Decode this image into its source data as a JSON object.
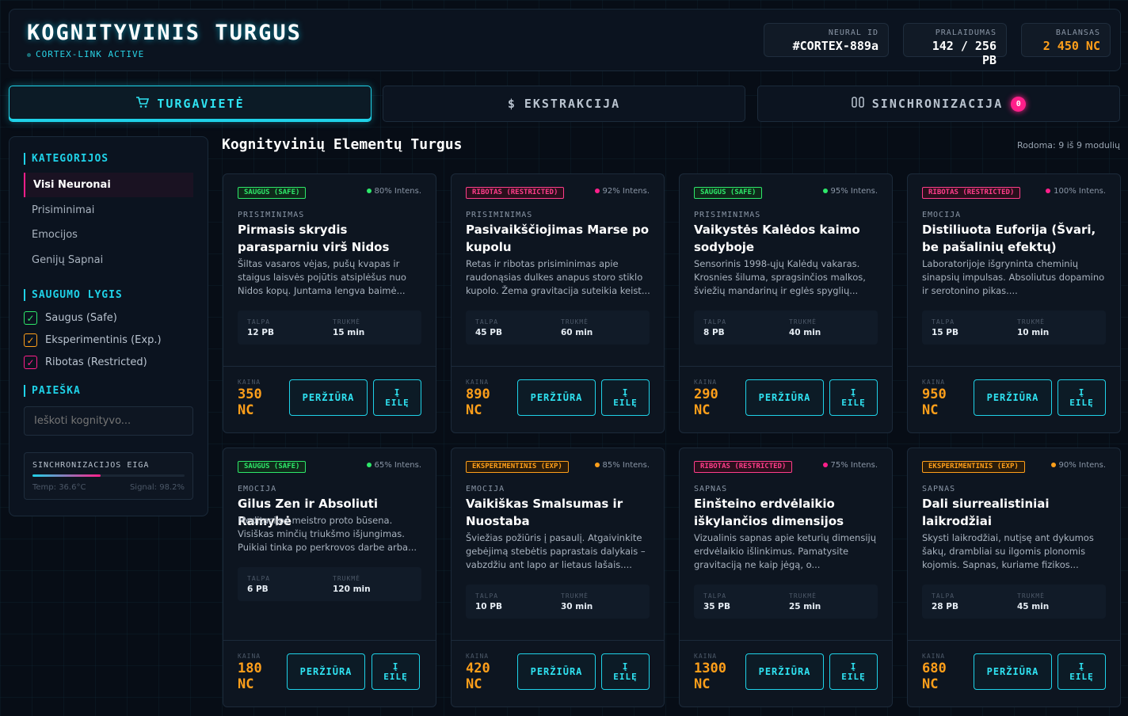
{
  "header": {
    "title": "KOGNITYVINIS TURGUS",
    "subtitle": "CORTEX-LINK ACTIVE",
    "stats": [
      {
        "label": "NEURAL ID",
        "value": "#CORTEX-889a"
      },
      {
        "label": "PRALAIDUMAS",
        "value": "142 / 256 PB"
      },
      {
        "label": "BALANSAS",
        "value": "2 450 NC"
      }
    ]
  },
  "tabs": [
    {
      "label": "TURGAVIETĖ",
      "icon": "cart-icon"
    },
    {
      "label": "EKSTRAKCIJA",
      "icon": "dollar-icon"
    },
    {
      "label": "SINCHRONIZACIJA",
      "icon": "sync-icon",
      "badge": "0"
    }
  ],
  "sidebar": {
    "categories_title": "KATEGORIJOS",
    "categories": [
      "Visi Neuronai",
      "Prisiminimai",
      "Emocijos",
      "Genijų Sapnai"
    ],
    "safety_title": "SAUGUMO LYGIS",
    "safety": [
      "Saugus (Safe)",
      "Eksperimentinis (Exp.)",
      "Ribotas (Restricted)"
    ],
    "search_title": "PAIEŠKA",
    "search_placeholder": "Ieškoti kognityvo...",
    "sync": {
      "title": "SINCHRONIZACIJOS EIGA",
      "temp": "Temp: 36.6°C",
      "signal": "Signal: 98.2%",
      "progress": 0.45
    }
  },
  "main": {
    "title": "Kognityvinių Elementų Turgus",
    "showing": "Rodoma: 9 iš 9 modulių"
  },
  "labels": {
    "capacity": "TALPA",
    "duration": "TRUKMĖ",
    "price": "KAINA",
    "view": "PERŽIŪRA",
    "queue_1": "Į",
    "queue_2": "EILĘ"
  },
  "cards": [
    {
      "badge": "SAUGUS (SAFE)",
      "intensity": "80% Intens.",
      "category": "PRISIMINIMAS",
      "name": "Pirmasis skrydis parasparniu virš Nidos",
      "desc": "Šiltas vasaros vėjas, pušų kvapas ir staigus laisvės pojūtis atsiplėšus nuo Nidos kopų. Juntama lengva baimė...",
      "capacity": "12 PB",
      "duration": "15 min",
      "price_1": "350",
      "price_2": "NC"
    },
    {
      "badge": "RIBOTAS (RESTRICTED)",
      "intensity": "92% Intens.",
      "category": "PRISIMINIMAS",
      "name": "Pasivaikščiojimas Marse po kupolu",
      "desc": "Retas ir ribotas prisiminimas apie raudonąsias dulkes anapus storo stiklo kupolo. Žema gravitacija suteikia keist...",
      "capacity": "45 PB",
      "duration": "60 min",
      "price_1": "890",
      "price_2": "NC"
    },
    {
      "badge": "SAUGUS (SAFE)",
      "intensity": "95% Intens.",
      "category": "PRISIMINIMAS",
      "name": "Vaikystės Kalėdos kaimo sodyboje",
      "desc": "Sensorinis 1998-ųjų Kalėdų vakaras. Krosnies šiluma, spragsinčios malkos, šviežių mandarinų ir eglės spyglių...",
      "capacity": "8 PB",
      "duration": "40 min",
      "price_1": "290",
      "price_2": "NC"
    },
    {
      "badge": "RIBOTAS (RESTRICTED)",
      "intensity": "100% Intens.",
      "category": "EMOCIJA",
      "name": "Distiliuota Euforija (Švari, be pašalinių efektų)",
      "desc": "Laboratorijoje išgryninta cheminių sinapsių impulsas. Absoliutus dopamino ir serotonino pikas....",
      "capacity": "15 PB",
      "duration": "10 min",
      "price_1": "950",
      "price_2": "NC"
    },
    {
      "badge": "SAUGUS (SAFE)",
      "intensity": "65% Intens.",
      "category": "EMOCIJA",
      "name": "Gilus Zen ir Absoliuti Ramybė",
      "desc": "Meditacijos meistro proto būsena. Visiškas minčių triukšmo išjungimas. Puikiai tinka po perkrovos darbe arba...",
      "capacity": "6 PB",
      "duration": "120 min",
      "price_1": "180",
      "price_2": "NC"
    },
    {
      "badge": "EKSPERIMENTINIS (EXP)",
      "intensity": "85% Intens.",
      "category": "EMOCIJA",
      "name": "Vaikiškas Smalsumas ir Nuostaba",
      "desc": "Šviežias požiūris į pasaulį. Atgaivinkite gebėjimą stebėtis paprastais dalykais – vabzdžiu ant lapo ar lietaus lašais....",
      "capacity": "10 PB",
      "duration": "30 min",
      "price_1": "420",
      "price_2": "NC"
    },
    {
      "badge": "RIBOTAS (RESTRICTED)",
      "intensity": "75% Intens.",
      "category": "SAPNAS",
      "name": "Einšteino erdvėlaikio iškylančios dimensijos",
      "desc": "Vizualinis sapnas apie keturių dimensijų erdvėlaikio išlinkimus. Pamatysite gravitaciją ne kaip jėgą, o...",
      "capacity": "35 PB",
      "duration": "25 min",
      "price_1": "1300",
      "price_2": "NC"
    },
    {
      "badge": "EKSPERIMENTINIS (EXP)",
      "intensity": "90% Intens.",
      "category": "SAPNAS",
      "name": "Dali siurrealistiniai laikrodžiai",
      "desc": "Skysti laikrodžiai, nutįsę ant dykumos šakų, drambliai su ilgomis plonomis kojomis. Sapnas, kuriame fizikos...",
      "capacity": "28 PB",
      "duration": "45 min",
      "price_1": "680",
      "price_2": "NC"
    }
  ],
  "colors": {
    "accent": "#1fd2e8",
    "pink": "#ff1f8a",
    "orange": "#ff9f1a",
    "green": "#2ee86a"
  }
}
